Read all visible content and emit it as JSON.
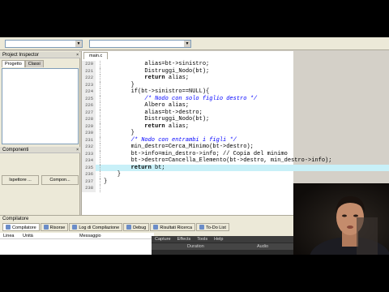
{
  "toolbar": {
    "combo1_value": "",
    "combo2_value": ""
  },
  "left_panel": {
    "project_title": "Project Inspector",
    "tabs": [
      "Progetto",
      "Classi"
    ],
    "components_title": "Componenti",
    "component_buttons": [
      "Ispettore ...",
      "Compon..."
    ]
  },
  "editor": {
    "tab": "main.c",
    "lines": [
      {
        "n": "220",
        "text": "            alias=bt->sinistro;",
        "style": ""
      },
      {
        "n": "221",
        "text": "            Distruggi_Nodo(bt);",
        "style": ""
      },
      {
        "n": "222",
        "text": "            return alias;",
        "style": ""
      },
      {
        "n": "223",
        "text": "        }",
        "style": ""
      },
      {
        "n": "224",
        "text": "        if(bt->sinistro==NULL){",
        "style": ""
      },
      {
        "n": "225",
        "text": "            /* Nodo con solo figlio destro */",
        "style": "comment"
      },
      {
        "n": "226",
        "text": "            Albero alias;",
        "style": ""
      },
      {
        "n": "227",
        "text": "            alias=bt->destro;",
        "style": ""
      },
      {
        "n": "228",
        "text": "            Distruggi_Nodo(bt);",
        "style": ""
      },
      {
        "n": "229",
        "text": "            return alias;",
        "style": ""
      },
      {
        "n": "230",
        "text": "        }",
        "style": ""
      },
      {
        "n": "231",
        "text": "        /* Nodo con entrambi i figli */",
        "style": "comment"
      },
      {
        "n": "232",
        "text": "        min_destro=Cerca_Minimo(bt->destro);",
        "style": ""
      },
      {
        "n": "233",
        "text": "        bt->info=min_destro->info; // Copia del minimo",
        "style": ""
      },
      {
        "n": "234",
        "text": "        bt->destro=Cancella_Elemento(bt->destro, min_destro->info);",
        "style": ""
      },
      {
        "n": "235",
        "text": "        return bt;",
        "style": "hl"
      },
      {
        "n": "236",
        "text": "    }",
        "style": ""
      },
      {
        "n": "237",
        "text": "}",
        "style": ""
      },
      {
        "n": "238",
        "text": "",
        "style": ""
      }
    ]
  },
  "bottom": {
    "title": "Compilatore",
    "tabs": [
      "Compilatore",
      "Risorse",
      "Log di Compilazione",
      "Debug",
      "Risultati Ricerca",
      "To-Do List"
    ],
    "columns": [
      "Linea",
      "Unità",
      "Messaggio"
    ]
  },
  "overlay": {
    "menu": [
      "Capture",
      "Effects",
      "Tools",
      "Help"
    ],
    "columns": [
      "Duration",
      "Audio"
    ]
  }
}
